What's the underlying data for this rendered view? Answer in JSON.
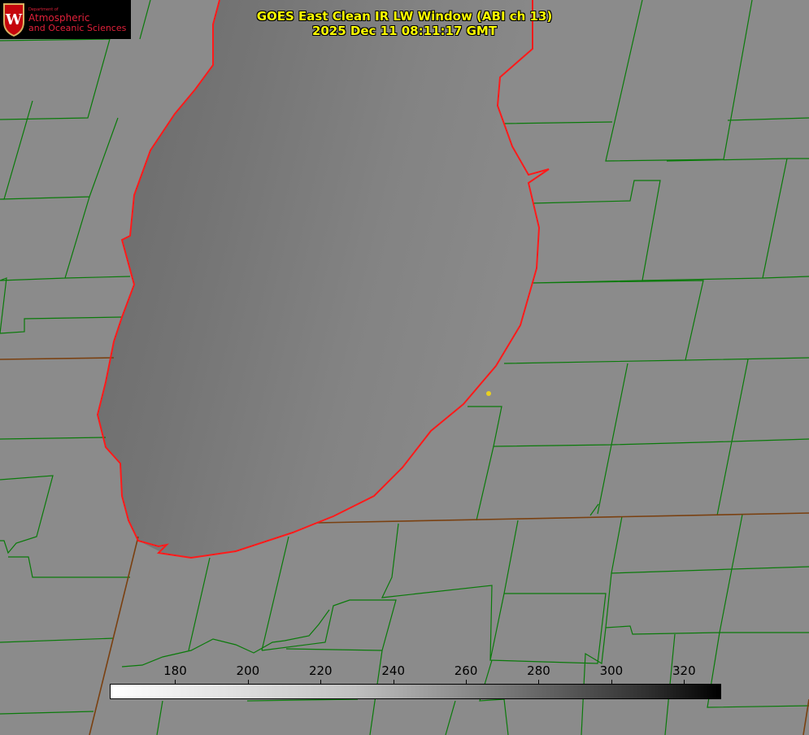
{
  "title": {
    "line1": "GOES East Clean IR LW Window (ABI ch 13)",
    "line2": "2025 Dec 11 08:11:17 GMT"
  },
  "logo": {
    "dept": "Department of",
    "line1": "Atmospheric",
    "line2": "and Oceanic Sciences",
    "crest_letter": "W"
  },
  "colorbar": {
    "min": 162,
    "max": 330,
    "ticks": [
      "180",
      "200",
      "220",
      "240",
      "260",
      "280",
      "300",
      "320"
    ],
    "colors": {
      "low": "#ffffff",
      "high": "#000000"
    }
  },
  "colors": {
    "county_lines": "#0a7a0a",
    "state_lines": "#8a3a10",
    "lake_outline": "#ff1a1a",
    "marker": "#e8d020"
  }
}
